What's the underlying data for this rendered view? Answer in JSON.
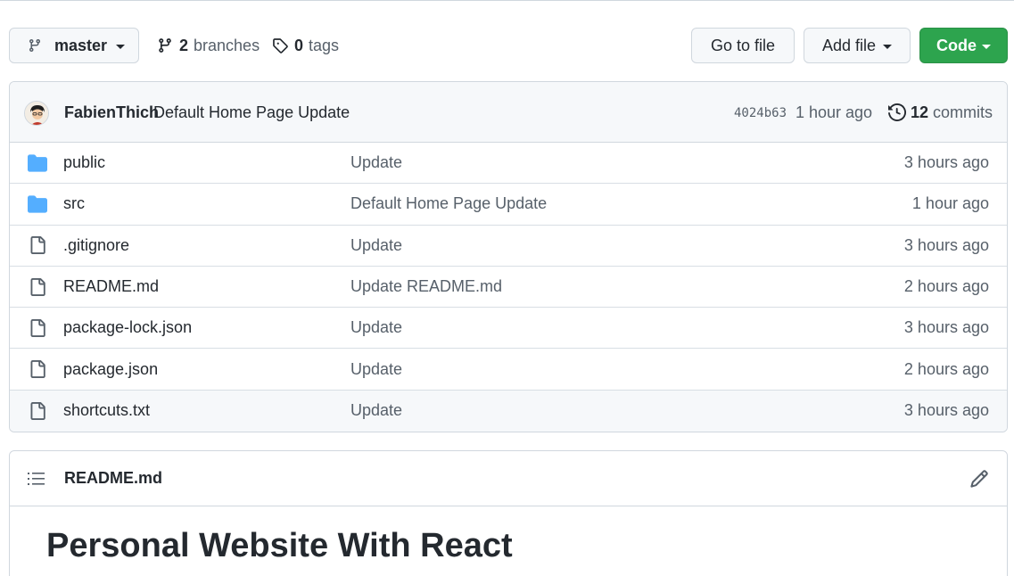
{
  "toolbar": {
    "branch_name": "master",
    "branches_count": "2",
    "branches_label": "branches",
    "tags_count": "0",
    "tags_label": "tags",
    "goto_file_label": "Go to file",
    "add_file_label": "Add file",
    "code_label": "Code"
  },
  "commit": {
    "author": "FabienThich",
    "message": "Default Home Page Update",
    "sha": "4024b63",
    "time": "1 hour ago",
    "commits_count": "12",
    "commits_label": "commits"
  },
  "files": [
    {
      "name": "public",
      "type": "folder",
      "message": "Update",
      "time": "3 hours ago"
    },
    {
      "name": "src",
      "type": "folder",
      "message": "Default Home Page Update",
      "time": "1 hour ago"
    },
    {
      "name": ".gitignore",
      "type": "file",
      "message": "Update",
      "time": "3 hours ago"
    },
    {
      "name": "README.md",
      "type": "file",
      "message": "Update README.md",
      "time": "2 hours ago"
    },
    {
      "name": "package-lock.json",
      "type": "file",
      "message": "Update",
      "time": "3 hours ago"
    },
    {
      "name": "package.json",
      "type": "file",
      "message": "Update",
      "time": "2 hours ago"
    },
    {
      "name": "shortcuts.txt",
      "type": "file",
      "message": "Update",
      "time": "3 hours ago"
    }
  ],
  "readme": {
    "title": "README.md",
    "heading": "Personal Website With React"
  },
  "colors": {
    "code_button": "#2da44e",
    "folder_icon": "#54aeff",
    "border": "#d0d7de"
  }
}
